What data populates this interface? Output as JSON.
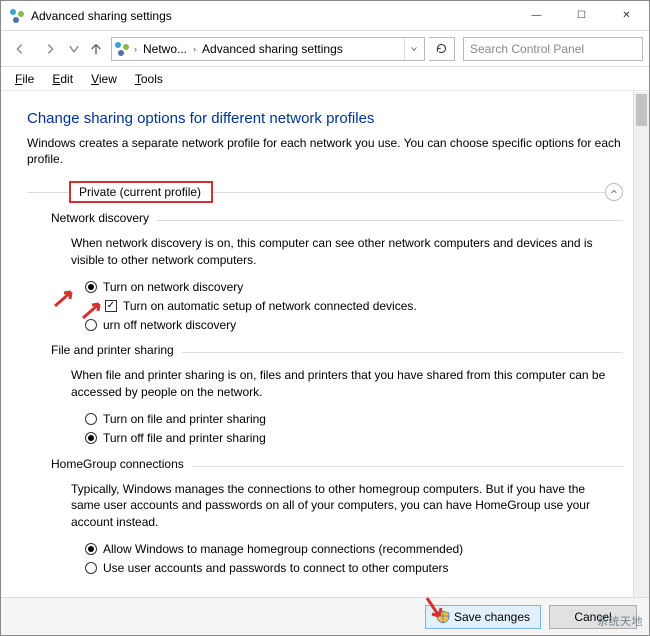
{
  "window": {
    "title": "Advanced sharing settings"
  },
  "nav": {
    "breadcrumb1": "Netwo...",
    "breadcrumb2": "Advanced sharing settings",
    "search_placeholder": "Search Control Panel"
  },
  "menubar": {
    "file": "File",
    "edit": "Edit",
    "view": "View",
    "tools": "Tools"
  },
  "heading": "Change sharing options for different network profiles",
  "subtext": "Windows creates a separate network profile for each network you use. You can choose specific options for each profile.",
  "profile": {
    "label": "Private (current profile)"
  },
  "groups": {
    "network_discovery": {
      "title": "Network discovery",
      "desc": "When network discovery is on, this computer can see other network computers and devices and is visible to other network computers.",
      "opt_on": "Turn on network discovery",
      "opt_auto": "Turn on automatic setup of network connected devices.",
      "opt_off": "urn off network discovery"
    },
    "file_printer": {
      "title": "File and printer sharing",
      "desc": "When file and printer sharing is on, files and printers that you have shared from this computer can be accessed by people on the network.",
      "opt_on": "Turn on file and printer sharing",
      "opt_off": "Turn off file and printer sharing"
    },
    "homegroup": {
      "title": "HomeGroup connections",
      "desc": "Typically, Windows manages the connections to other homegroup computers. But if you have the same user accounts and passwords on all of your computers, you can have HomeGroup use your account instead.",
      "opt_allow": "Allow Windows to manage homegroup connections (recommended)",
      "opt_user": "Use user accounts and passwords to connect to other computers"
    }
  },
  "footer": {
    "save": "Save changes",
    "cancel": "Cancel"
  },
  "watermark": "系统天地"
}
